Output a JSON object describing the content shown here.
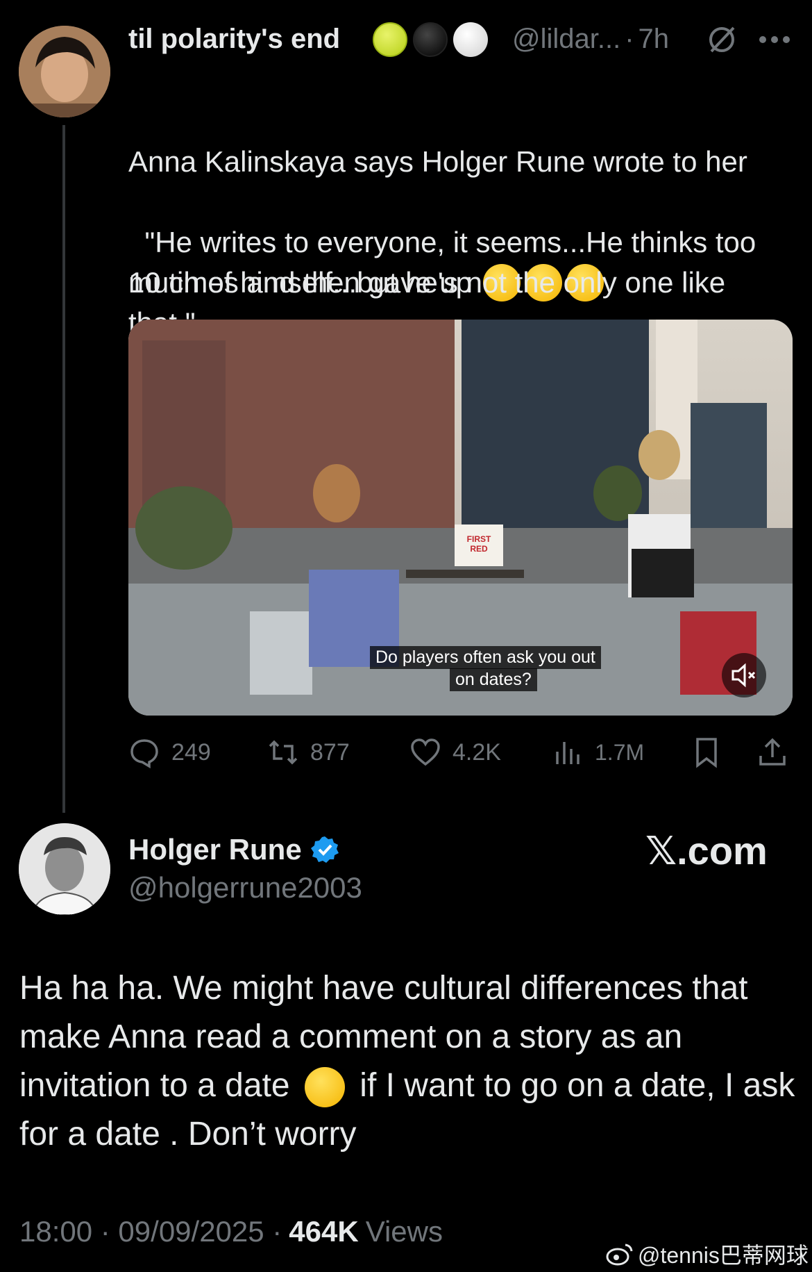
{
  "original_tweet": {
    "display_name": "til polarity's end",
    "handle": "@lildar...",
    "time_sep": "·",
    "time": "7h",
    "text_line1": "Anna Kalinskaya says Holger Rune wrote to her",
    "text_line2": "10 times and then gave up",
    "text_quote": "\"He writes to everyone, it seems...He thinks too much of himself...but he's not the only one like that.\"",
    "avatar_icon": "profile-avatar-icon",
    "media": {
      "caption_line1": "Do players often ask you out",
      "caption_line2": "on dates?",
      "sign_text_line1": "FIRST",
      "sign_text_line2": "RED"
    },
    "stats": {
      "replies": "249",
      "reposts": "877",
      "likes": "4.2K",
      "views": "1.7M"
    }
  },
  "reply_tweet": {
    "display_name": "Holger Rune",
    "handle": "@holgerrune2003",
    "text_part1": "Ha ha ha. We might have cultural differences that make Anna read a comment on a story as an invitation to a date",
    "text_part2": "if I want to go on a date, I ask for a date . Don’t worry",
    "timestamp": "18:00 · 09/09/2025 ·",
    "views_count": "464K",
    "views_label": "Views"
  },
  "branding": {
    "x_logo": "𝕏.com",
    "watermark": "@tennis巴蒂网球"
  },
  "colors": {
    "background": "#000000",
    "text": "#e7e9ea",
    "muted": "#71767b",
    "verified": "#1d9bf0"
  }
}
